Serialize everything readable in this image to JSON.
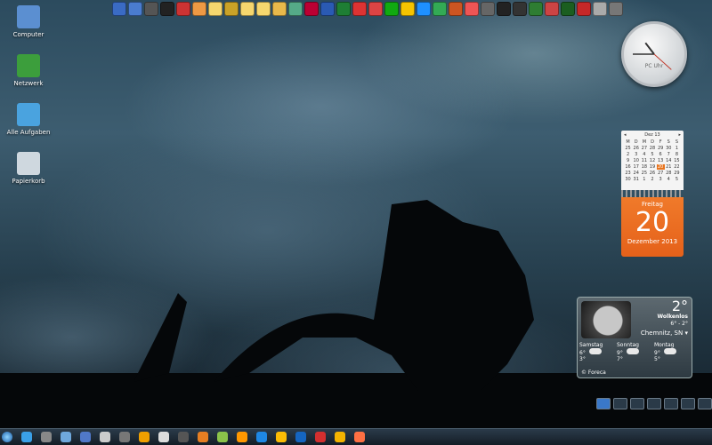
{
  "desktop": {
    "icons": [
      {
        "label": "Computer",
        "icon": "computer-icon",
        "color": "#5b8fd1"
      },
      {
        "label": "Netzwerk",
        "icon": "network-icon",
        "color": "#3c9e3c"
      },
      {
        "label": "Alle Aufgaben",
        "icon": "tasks-icon",
        "color": "#4aa3df"
      },
      {
        "label": "Papierkorb",
        "icon": "recycle-bin-icon",
        "color": "#cfd8df"
      }
    ]
  },
  "quicklaunch": {
    "colors": [
      "#3a6bc4",
      "#4a7ccf",
      "#555",
      "#222",
      "#c33",
      "#e94",
      "#f5d76e",
      "#c9a227",
      "#f5d76e",
      "#f5d76e",
      "#e8b94b",
      "#5a8",
      "#b03",
      "#2a5ab3",
      "#1e7e34",
      "#d33",
      "#d44",
      "#1a1",
      "#f5c400",
      "#1e90ff",
      "#3a5",
      "#c52",
      "#e55",
      "#666",
      "#222",
      "#333",
      "#2e7d32",
      "#c44",
      "#1b5e20",
      "#c62828",
      "#aaa",
      "#777"
    ]
  },
  "clock": {
    "label": "PC Uhr",
    "hour": 10,
    "minute": 45,
    "second": 22
  },
  "calendar": {
    "month": "Dez 13",
    "weekday_headers": [
      "M",
      "D",
      "M",
      "D",
      "F",
      "S",
      "S"
    ],
    "days": [
      "25",
      "26",
      "27",
      "28",
      "29",
      "30",
      "1",
      "2",
      "3",
      "4",
      "5",
      "6",
      "7",
      "8",
      "9",
      "10",
      "11",
      "12",
      "13",
      "14",
      "15",
      "16",
      "17",
      "18",
      "19",
      "20",
      "21",
      "22",
      "23",
      "24",
      "25",
      "26",
      "27",
      "28",
      "29",
      "30",
      "31",
      "1",
      "2",
      "3",
      "4",
      "5"
    ],
    "highlight": "20",
    "weekday": "Freitag",
    "day": "20",
    "month_year": "Dezember 2013"
  },
  "weather": {
    "temp": "2°",
    "condition": "Wolkenlos",
    "range": "6° - 2°",
    "location": "Chemnitz, SN",
    "days": [
      {
        "name": "Samstag",
        "hi": "6°",
        "lo": "3°"
      },
      {
        "name": "Sonntag",
        "hi": "9°",
        "lo": "7°"
      },
      {
        "name": "Montag",
        "hi": "9°",
        "lo": "5°"
      }
    ],
    "source": "© Foreca"
  },
  "virtual_desktops": {
    "count": 7,
    "active": 0
  },
  "taskbar": {
    "colors": [
      "#3aa0e8",
      "#888",
      "#6fa8dc",
      "#5078c8",
      "#ccc",
      "#777",
      "#f0a000",
      "#ddd",
      "#555",
      "#e67e22",
      "#8bc34a",
      "#ff9800",
      "#1e88e5",
      "#fbbc05",
      "#1565c0",
      "#d32f2f",
      "#f4b400",
      "#ff7043"
    ]
  }
}
